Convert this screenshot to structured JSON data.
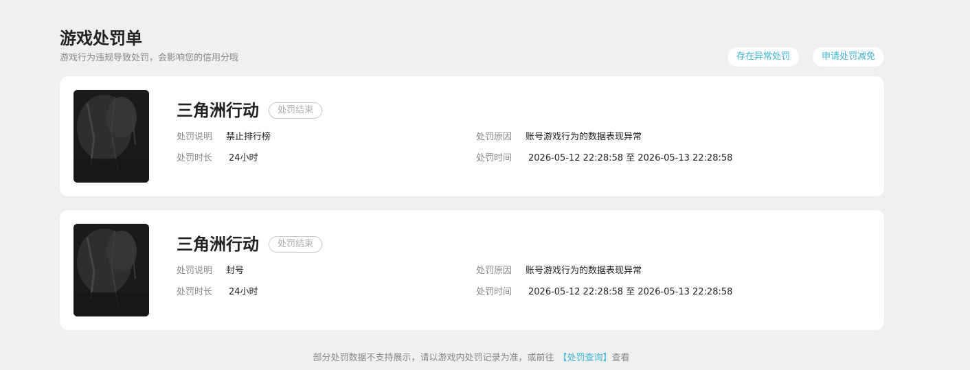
{
  "header": {
    "title": "游戏处罚单",
    "subtitle": "游戏行为违规导致处罚，会影响您的信用分哦",
    "actions": [
      {
        "label": "存在异常处罚"
      },
      {
        "label": "申请处罚减免"
      }
    ]
  },
  "labels": {
    "desc": "处罚说明",
    "duration": "处罚时长",
    "reason": "处罚原因",
    "time": "处罚时间"
  },
  "records": [
    {
      "game": "三角洲行动",
      "status": "处罚结束",
      "desc": "禁止排行榜",
      "duration": "24小时",
      "reason": "账号游戏行为的数据表现异常",
      "time": "2026-05-12 22:28:58 至 2026-05-13 22:28:58"
    },
    {
      "game": "三角洲行动",
      "status": "处罚结束",
      "desc": "封号",
      "duration": "24小时",
      "reason": "账号游戏行为的数据表现异常",
      "time": "2026-05-12 22:28:58 至 2026-05-13 22:28:58"
    }
  ],
  "footer": {
    "text": "部分处罚数据不支持展示，请以游戏内处罚记录为准，或前往",
    "link": "【处罚查询】",
    "suffix": "查看"
  },
  "colors": {
    "accent": "#3bb4d6",
    "background": "#f0f0f0"
  }
}
